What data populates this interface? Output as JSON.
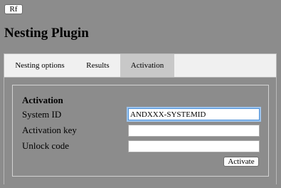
{
  "toolbar": {
    "rf_label": "Rf"
  },
  "page": {
    "title": "Nesting Plugin"
  },
  "tabs": [
    {
      "label": "Nesting options",
      "active": false
    },
    {
      "label": "Results",
      "active": false
    },
    {
      "label": "Activation",
      "active": true
    }
  ],
  "activation": {
    "heading": "Activation",
    "system_id_label": "System ID",
    "system_id_value": "ANDXXX-SYSTEMID",
    "activation_key_label": "Activation key",
    "activation_key_value": "",
    "unlock_code_label": "Unlock code",
    "unlock_code_value": "",
    "activate_label": "Activate"
  },
  "colors": {
    "page_background": "#8c8c8c",
    "tab_bar_background": "#f0f0f0",
    "active_tab_background": "#c8c8c8",
    "focus_ring": "#4a8fd8"
  }
}
